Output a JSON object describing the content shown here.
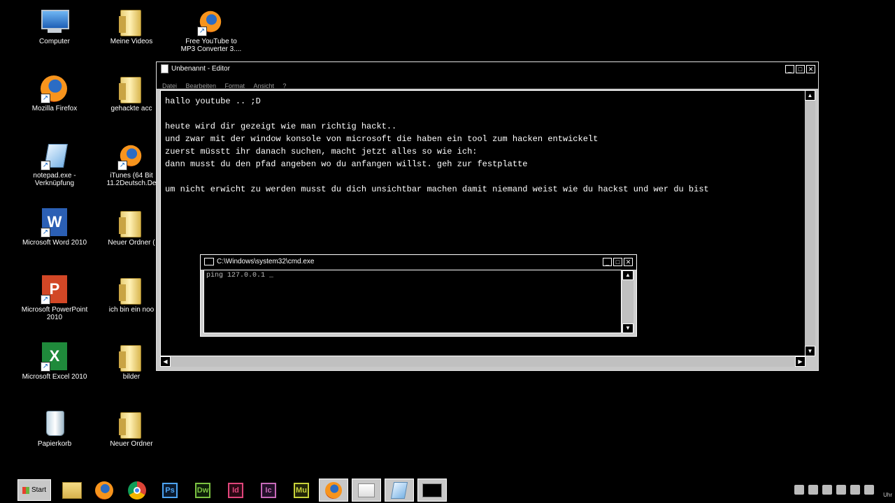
{
  "desktop": {
    "icons": [
      {
        "label": "Computer",
        "icon": "computer-icon"
      },
      {
        "label": "Meine Videos",
        "icon": "folder-icon"
      },
      {
        "label": "Free YouTube to MP3 Converter 3....",
        "icon": "firefox-doc-icon"
      },
      {
        "label": "Mozilla Firefox",
        "icon": "firefox-icon"
      },
      {
        "label": "gehackte acc",
        "icon": "folder-icon"
      },
      {
        "label": "notepad.exe - Verknüpfung",
        "icon": "notepad-icon"
      },
      {
        "label": "iTunes (64 Bit 11.2Deutsch.De",
        "icon": "firefox-doc-icon"
      },
      {
        "label": "Microsoft Word 2010",
        "icon": "word-icon"
      },
      {
        "label": "Neuer Ordner (",
        "icon": "folder-icon"
      },
      {
        "label": "Microsoft PowerPoint 2010",
        "icon": "powerpoint-icon"
      },
      {
        "label": "ich bin ein noo",
        "icon": "folder-icon"
      },
      {
        "label": "Microsoft Excel 2010",
        "icon": "excel-icon"
      },
      {
        "label": "bilder",
        "icon": "folder-icon"
      },
      {
        "label": "Papierkorb",
        "icon": "recycle-bin-icon"
      },
      {
        "label": "Neuer Ordner",
        "icon": "folder-icon"
      }
    ]
  },
  "notepad": {
    "title": "Unbenannt - Editor",
    "menu": [
      "Datei",
      "Bearbeiten",
      "Format",
      "Ansicht",
      "?"
    ],
    "text": "hallo youtube .. ;D\n\nheute wird dir gezeigt wie man richtig hackt..\nund zwar mit der window konsole von microsoft die haben ein tool zum hacken entwickelt\nzuerst müsstt ihr danach suchen, macht jetzt alles so wie ich:\ndann musst du den pfad angeben wo du anfangen willst. geh zur festplatte\n\num nicht erwicht zu werden musst du dich unsichtbar machen damit niemand weist wie du hackst und wer du bist"
  },
  "cmd": {
    "title": "C:\\Windows\\system32\\cmd.exe",
    "content": "ping 127.0.0.1 _"
  },
  "taskbar": {
    "start_label": "Start",
    "apps": [
      {
        "name": "explorer",
        "label": ""
      },
      {
        "name": "firefox",
        "label": ""
      },
      {
        "name": "chrome",
        "label": ""
      },
      {
        "name": "photoshop",
        "label": "Ps",
        "color": "#4ea5f5"
      },
      {
        "name": "dreamweaver",
        "label": "Dw",
        "color": "#7cc242"
      },
      {
        "name": "indesign",
        "label": "Id",
        "color": "#e0457b"
      },
      {
        "name": "incopy",
        "label": "Ic",
        "color": "#c76ab8"
      },
      {
        "name": "muse",
        "label": "Mu",
        "color": "#c8d23a"
      }
    ],
    "clock": "Uhr"
  }
}
